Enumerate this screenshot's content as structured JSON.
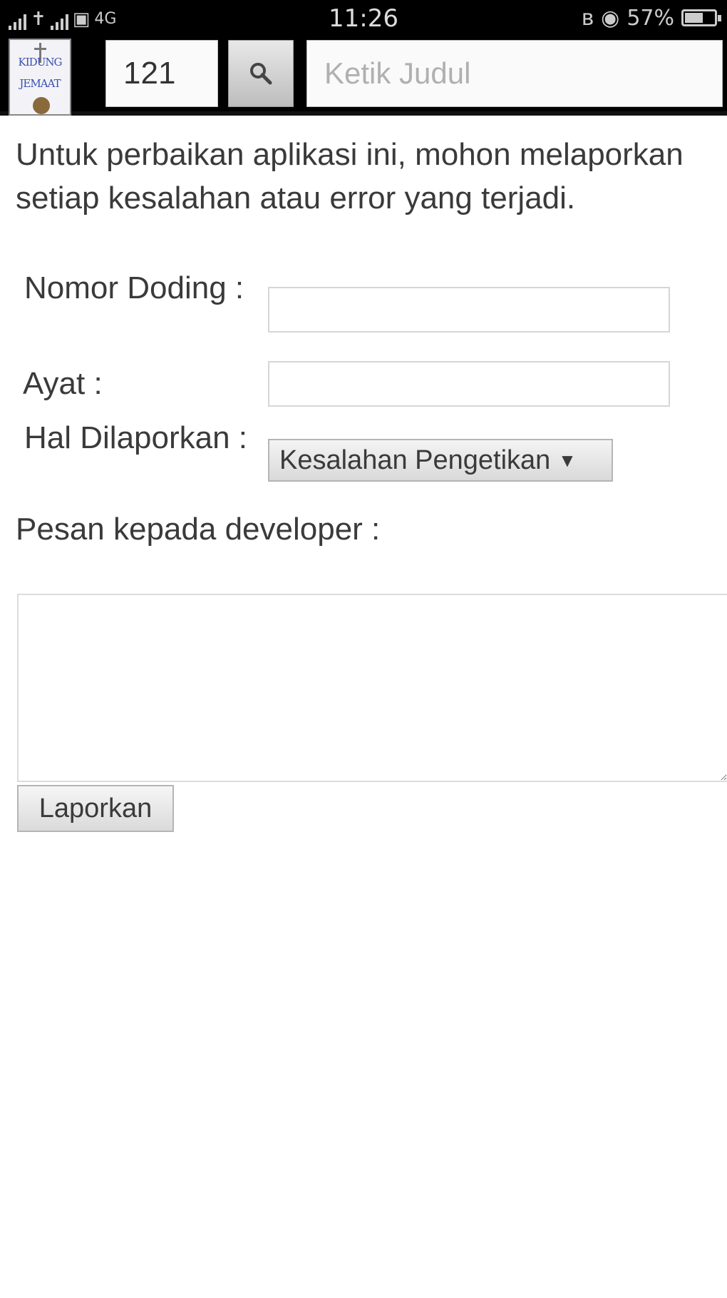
{
  "status_bar": {
    "time": "11:26",
    "battery": "57%",
    "battery_level": 0.57,
    "network": "4G"
  },
  "toolbar": {
    "logo_line1": "KIDUNG",
    "logo_line2": "JEMAAT",
    "number_value": "121",
    "search_icon": "search-icon",
    "title_placeholder": "Ketik Judul"
  },
  "form": {
    "intro": "Untuk perbaikan aplikasi ini, mohon melaporkan setiap kesalahan atau error yang terjadi.",
    "nomor_label": "Nomor Doding :",
    "ayat_label": "Ayat :",
    "hal_label": "Hal Dilaporkan :",
    "hal_selected": "Kesalahan Pengetikan",
    "pesan_label": "Pesan kepada developer :",
    "submit_label": "Laporkan"
  }
}
